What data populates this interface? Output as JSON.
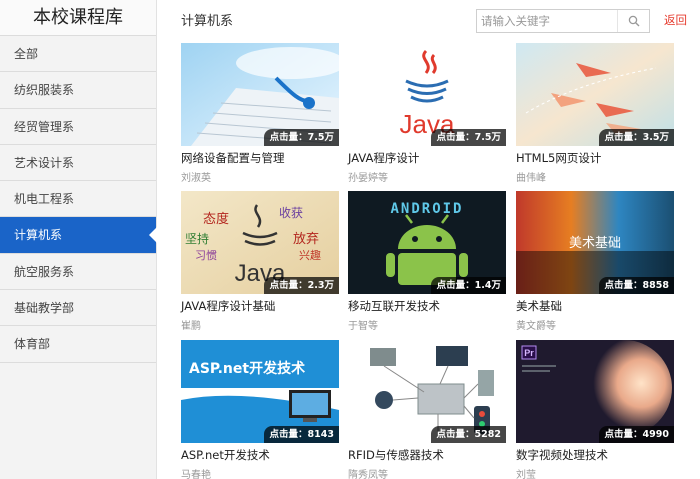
{
  "sidebar": {
    "title": "本校课程库",
    "items": [
      {
        "label": "全部"
      },
      {
        "label": "纺织服装系"
      },
      {
        "label": "经贸管理系"
      },
      {
        "label": "艺术设计系"
      },
      {
        "label": "机电工程系"
      },
      {
        "label": "计算机系",
        "active": true
      },
      {
        "label": "航空服务系"
      },
      {
        "label": "基础教学部"
      },
      {
        "label": "体育部"
      }
    ]
  },
  "header": {
    "title": "计算机系",
    "search_placeholder": "请输入关键字",
    "search_icon": "search-icon",
    "back_label": "返回"
  },
  "colors": {
    "accent": "#1a64c8",
    "back_link": "#e63b2e",
    "sidebar_bg": "#f3f3f3"
  },
  "courses": [
    {
      "title": "网络设备配置与管理",
      "author": "刘淑英",
      "clicks": "点击量：7.5万"
    },
    {
      "title": "JAVA程序设计",
      "author": "孙晏婷等",
      "clicks": "点击量：7.5万"
    },
    {
      "title": "HTML5网页设计",
      "author": "曲伟峰",
      "clicks": "点击量：3.5万"
    },
    {
      "title": "JAVA程序设计基础",
      "author": "崔鹏",
      "clicks": "点击量：2.3万"
    },
    {
      "title": "移动互联开发技术",
      "author": "于智等",
      "clicks": "点击量：1.4万"
    },
    {
      "title": "美术基础",
      "author": "黄文爵等",
      "clicks": "点击量：8858"
    },
    {
      "title": "ASP.net开发技术",
      "author": "马春艳",
      "clicks": "点击量：8143"
    },
    {
      "title": "RFID与传感器技术",
      "author": "隋秀凤等",
      "clicks": "点击量：5282"
    },
    {
      "title": "数字视频处理技术",
      "author": "刘莹",
      "clicks": "点击量：4990"
    }
  ],
  "thumb_text": {
    "java_logo": "Java",
    "java_words": [
      "态度",
      "收获",
      "坚持",
      "放弃",
      "习惯",
      "兴趣"
    ],
    "android_logo": "ANDROID",
    "art_logo": "美术基础",
    "asp_banner": "ASP.net开发技术",
    "pr_badge": "Pr"
  }
}
